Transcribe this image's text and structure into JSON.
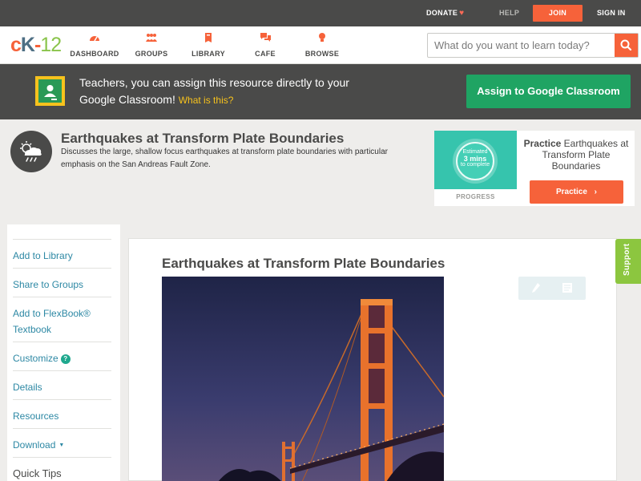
{
  "topbar": {
    "donate": "DONATE",
    "help": "HELP",
    "join": "JOIN",
    "sign_in": "SIGN IN"
  },
  "logo": {
    "text": "cK-12"
  },
  "nav": [
    {
      "label": "DASHBOARD",
      "icon": "dashboard-icon"
    },
    {
      "label": "GROUPS",
      "icon": "groups-icon"
    },
    {
      "label": "LIBRARY",
      "icon": "library-icon"
    },
    {
      "label": "CAFE",
      "icon": "cafe-icon"
    },
    {
      "label": "BROWSE",
      "icon": "browse-icon"
    }
  ],
  "search": {
    "placeholder": "What do you want to learn today?",
    "value": ""
  },
  "banner": {
    "text": "Teachers, you can assign this resource directly to your Google Classroom!",
    "what_is_this": "What is this?",
    "assign_button": "Assign to Google Classroom"
  },
  "concept": {
    "title": "Earthquakes at Transform Plate Boundaries",
    "description": "Discusses the large, shallow focus earthquakes at transform plate boundaries with particular emphasis on the San Andreas Fault Zone."
  },
  "practice": {
    "estimated": "Estimated",
    "minutes": "3 mins",
    "to_complete": "to complete",
    "progress_label": "PROGRESS",
    "heading_bold": "Practice",
    "heading_rest": "Earthquakes at Transform Plate Boundaries",
    "button": "Practice"
  },
  "sidebar": {
    "items": [
      {
        "label": "Add to Library"
      },
      {
        "label": "Share to Groups"
      },
      {
        "label": "Add to FlexBook® Textbook"
      },
      {
        "label": "Customize"
      },
      {
        "label": "Details"
      },
      {
        "label": "Resources"
      },
      {
        "label": "Download"
      },
      {
        "label": "Quick Tips"
      }
    ]
  },
  "main": {
    "title": "Earthquakes at Transform Plate Boundaries"
  },
  "support": "Support",
  "colors": {
    "accent": "#f6623a",
    "dark_bar": "#4a4a49",
    "classroom_green": "#1fa463",
    "link": "#2d88a4",
    "support_green": "#8cc63f"
  }
}
